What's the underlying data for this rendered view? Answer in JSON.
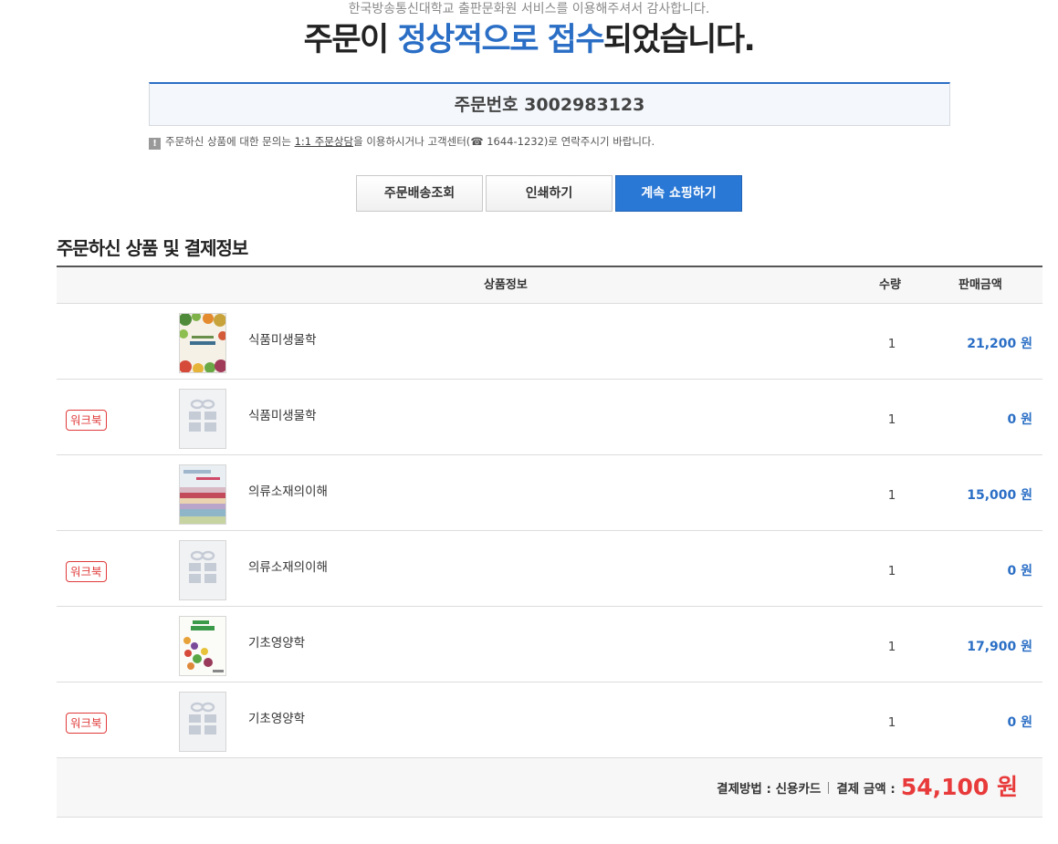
{
  "header": {
    "thanks": "한국방송통신대학교 출판문화원 서비스를 이용해주셔서 감사합니다.",
    "headline_pre": "주문이 ",
    "headline_highlight": "정상적으로 접수",
    "headline_post": "되었습니다."
  },
  "order": {
    "label": "주문번호",
    "number": "3002983123"
  },
  "notice": {
    "icon_text": "!",
    "text_before": "주문하신 상품에 대한 문의는 ",
    "link_text": "1:1 주문상담",
    "text_after": "을 이용하시거나 고객센터(☎ 1644-1232)로 연락주시기 바랍니다."
  },
  "buttons": {
    "track": "주문배송조회",
    "print": "인쇄하기",
    "continue": "계속 쇼핑하기"
  },
  "section_title": "주문하신 상품 및 결제정보",
  "table": {
    "headers": {
      "product": "상품정보",
      "qty": "수량",
      "price": "판매금액"
    },
    "rows": [
      {
        "badge": "",
        "name": "식품미생물학",
        "qty": "1",
        "price": "21,200 원",
        "thumb": "book-cover-food-microbiology"
      },
      {
        "badge": "워크북",
        "name": "식품미생물학",
        "qty": "1",
        "price": "0 원",
        "thumb": "gift-placeholder"
      },
      {
        "badge": "",
        "name": "의류소재의이해",
        "qty": "1",
        "price": "15,000 원",
        "thumb": "book-cover-textiles"
      },
      {
        "badge": "워크북",
        "name": "의류소재의이해",
        "qty": "1",
        "price": "0 원",
        "thumb": "gift-placeholder"
      },
      {
        "badge": "",
        "name": "기초영양학",
        "qty": "1",
        "price": "17,900 원",
        "thumb": "book-cover-basic-nutrition"
      },
      {
        "badge": "워크북",
        "name": "기초영양학",
        "qty": "1",
        "price": "0 원",
        "thumb": "gift-placeholder"
      }
    ]
  },
  "summary": {
    "method_label": "결제방법 : 신용카드",
    "amount_label": "결제 금액 :",
    "amount": "54,100 원"
  },
  "colors": {
    "accent_blue": "#2a6ec5",
    "button_blue": "#2a78d5",
    "total_red": "#e83a3a",
    "badge_red": "#e03a3a"
  }
}
